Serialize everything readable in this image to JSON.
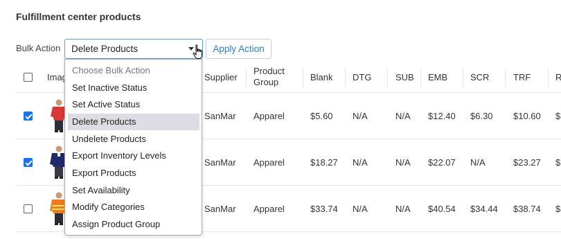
{
  "page": {
    "title": "Fulfillment center products"
  },
  "bulk": {
    "label": "Bulk Action",
    "selected": "Delete Products",
    "apply_label": "Apply Action",
    "options": [
      "Choose Bulk Action",
      "Set Inactive Status",
      "Set Active Status",
      "Delete Products",
      "Undelete Products",
      "Export Inventory Levels",
      "Export Products",
      "Set Availability",
      "Modify Categories",
      "Assign Product Group"
    ]
  },
  "table": {
    "headers": {
      "image": "Image",
      "supplier": "Supplier",
      "product_group_1": "Product",
      "product_group_2": "Group",
      "blank": "Blank",
      "dtg": "DTG",
      "sub": "SUB",
      "emb": "EMB",
      "scr": "SCR",
      "trf": "TRF",
      "r": "R"
    },
    "rows": [
      {
        "checked": true,
        "supplier": "SanMar",
        "group": "Apparel",
        "blank": "$5.60",
        "dtg": "N/A",
        "sub": "N/A",
        "emb": "$12.40",
        "scr": "$6.30",
        "trf": "$10.60"
      },
      {
        "checked": true,
        "supplier": "SanMar",
        "group": "Apparel",
        "blank": "$18.27",
        "dtg": "N/A",
        "sub": "N/A",
        "emb": "$22.07",
        "scr": "N/A",
        "trf": "$23.27"
      },
      {
        "checked": false,
        "supplier": "SanMar",
        "group": "Apparel",
        "blank": "$33.74",
        "dtg": "N/A",
        "sub": "N/A",
        "emb": "$40.54",
        "scr": "$34.44",
        "trf": "$38.74"
      }
    ]
  },
  "colors": {
    "accent": "#1a73e8",
    "link": "#2a7fc9",
    "selected_bg": "#dcdce2"
  }
}
